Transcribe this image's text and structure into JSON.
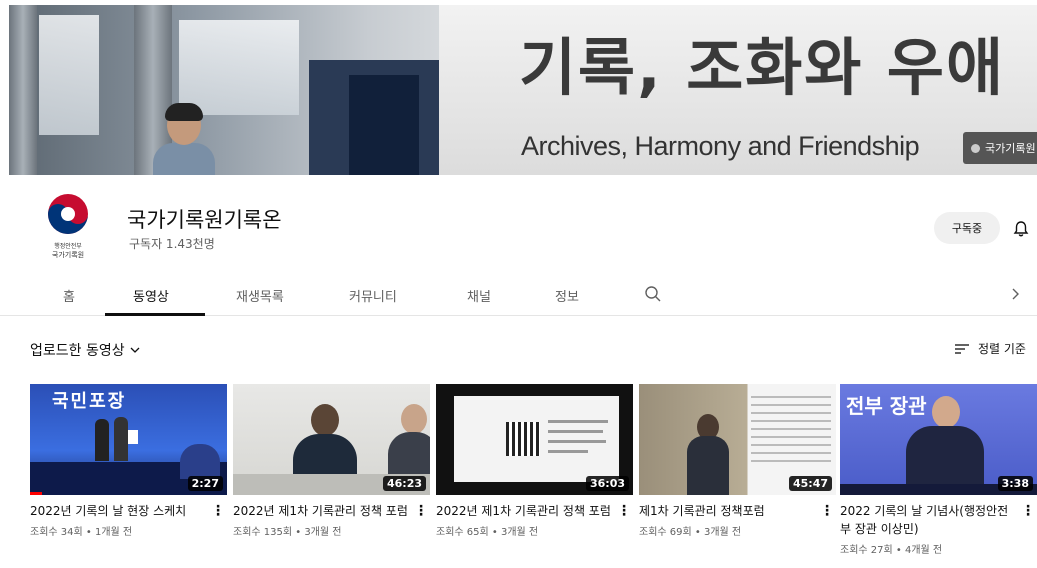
{
  "banner": {
    "title": "기록, 조화와 우애",
    "subtitle": "Archives, Harmony and Friendship",
    "badge": "국가기록원"
  },
  "channel": {
    "name": "국가기록원기록온",
    "subscribers": "구독자 1.43천명",
    "logo_line1": "행정안전부",
    "logo_line2": "국가기록원",
    "subscribe_label": "구독중",
    "bell_icon": "bell-icon"
  },
  "tabs": [
    {
      "label": "홈"
    },
    {
      "label": "동영상"
    },
    {
      "label": "재생목록"
    },
    {
      "label": "커뮤니티"
    },
    {
      "label": "채널"
    },
    {
      "label": "정보"
    }
  ],
  "section": {
    "title": "업로드한 동영상",
    "sort_label": "정렬 기준"
  },
  "videos": [
    {
      "title": "2022년 기록의 날 현장 스케치",
      "meta": "조회수 34회 • 1개월 전",
      "duration": "2:27",
      "thumb_text": "국민포장"
    },
    {
      "title": "2022년 제1차 기록관리 정책 포럼",
      "meta": "조회수 135회 • 3개월 전",
      "duration": "46:23"
    },
    {
      "title": "2022년 제1차 기록관리 정책 포럼",
      "meta": "조회수 65회 • 3개월 전",
      "duration": "36:03"
    },
    {
      "title": "제1차 기록관리 정책포럼",
      "meta": "조회수 69회 • 3개월 전",
      "duration": "45:47"
    },
    {
      "title": "2022 기록의 날 기념사(행정안전부 장관 이상민)",
      "meta": "조회수 27회 • 4개월 전",
      "duration": "3:38",
      "thumb_text": "전부 장관"
    }
  ]
}
